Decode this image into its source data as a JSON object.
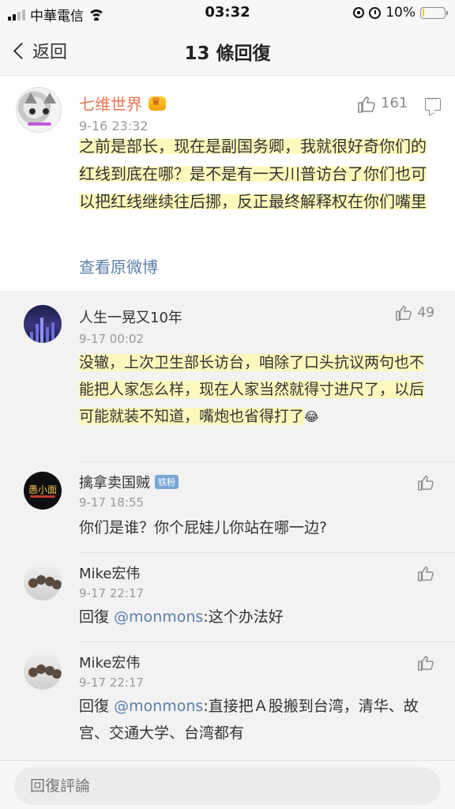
{
  "status_bar": {
    "carrier": "中華電信",
    "time": "03:32",
    "battery": "10%",
    "battery_level": 0.1
  },
  "nav": {
    "back_label": "返回",
    "title": "13 條回復"
  },
  "main_comment": {
    "author": "七维世界",
    "time": "9-16 23:32",
    "likes": "161",
    "text": "之前是部长，现在是副国务卿，我就很好奇你们的红线到底在哪？是不是有一天川普访台了你们也可以把红线继续往后挪，反正最终解释权在你们嘴里",
    "view_original": "查看原微博"
  },
  "replies": [
    {
      "author": "人生一晃又10年",
      "time": "9-17 00:02",
      "likes": "49",
      "text": "没辙，上次卫生部长访台，咱除了口头抗议两句也不能把人家怎么样，现在人家当然就得寸进尺了，以后可能就装不知道，嘴炮也省得打了",
      "emoji": "😂"
    },
    {
      "author": "擒拿卖国贼",
      "badge": "铁粉",
      "avatar_text": "愚小面",
      "time": "9-17 18:55",
      "text": "你们是谁？你个屁娃儿你站在哪一边?"
    },
    {
      "author": "Mike宏伟",
      "time": "9-17 22:17",
      "reply_prefix": "回復",
      "mention": "@monmons",
      "text": ":这个办法好"
    },
    {
      "author": "Mike宏伟",
      "time": "9-17 22:17",
      "reply_prefix": "回復",
      "mention": "@monmons",
      "text": ":直接把Ａ股搬到台湾，清华、故宫、交通大学、台湾都有"
    }
  ],
  "input": {
    "placeholder": "回復評論"
  },
  "colors": {
    "author_orange": "#eb7350",
    "link_blue": "#5b7fab",
    "highlight": "#fff8b4"
  },
  "icons": [
    "signal-icon",
    "wifi-icon",
    "rotation-lock-icon",
    "alarm-icon",
    "battery-icon",
    "back-chevron-icon",
    "thumbs-up-icon",
    "reply-comment-icon",
    "vip-badge-icon"
  ]
}
